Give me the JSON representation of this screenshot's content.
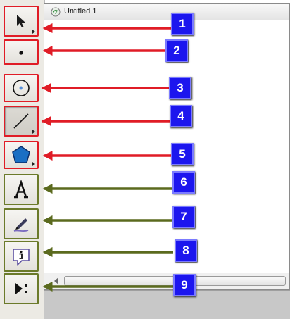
{
  "document": {
    "title": "Untitled 1",
    "icon": "sketchpad-document-icon"
  },
  "tools": [
    {
      "name": "arrow-selection-tool",
      "icon": "arrow-pointer-icon",
      "callout": "1",
      "box_color": "red",
      "has_submenu": true
    },
    {
      "name": "point-tool",
      "icon": "point-icon",
      "callout": "2",
      "box_color": "red",
      "has_submenu": false
    },
    {
      "name": "compass-tool",
      "icon": "circle-icon",
      "callout": "3",
      "box_color": "red",
      "has_submenu": false
    },
    {
      "name": "straightedge-tool",
      "icon": "line-segment-icon",
      "callout": "4",
      "box_color": "red",
      "has_submenu": true
    },
    {
      "name": "polygon-tool",
      "icon": "pentagon-icon",
      "callout": "5",
      "box_color": "red",
      "has_submenu": true
    },
    {
      "name": "text-tool",
      "icon": "letter-a-icon",
      "callout": "6",
      "box_color": "green",
      "has_submenu": false
    },
    {
      "name": "marker-tool",
      "icon": "marker-pen-icon",
      "callout": "7",
      "box_color": "green",
      "has_submenu": false
    },
    {
      "name": "information-tool",
      "icon": "info-balloon-icon",
      "callout": "8",
      "box_color": "green",
      "has_submenu": false
    },
    {
      "name": "custom-tools-menu",
      "icon": "play-triangle-dots-icon",
      "callout": "9",
      "box_color": "green",
      "has_submenu": false
    }
  ],
  "colors": {
    "callout_fill": "#1c16ee",
    "red_arrow": "#e01c26",
    "green_arrow": "#5b6a1e",
    "polygon_fill": "#1a6fc4"
  }
}
